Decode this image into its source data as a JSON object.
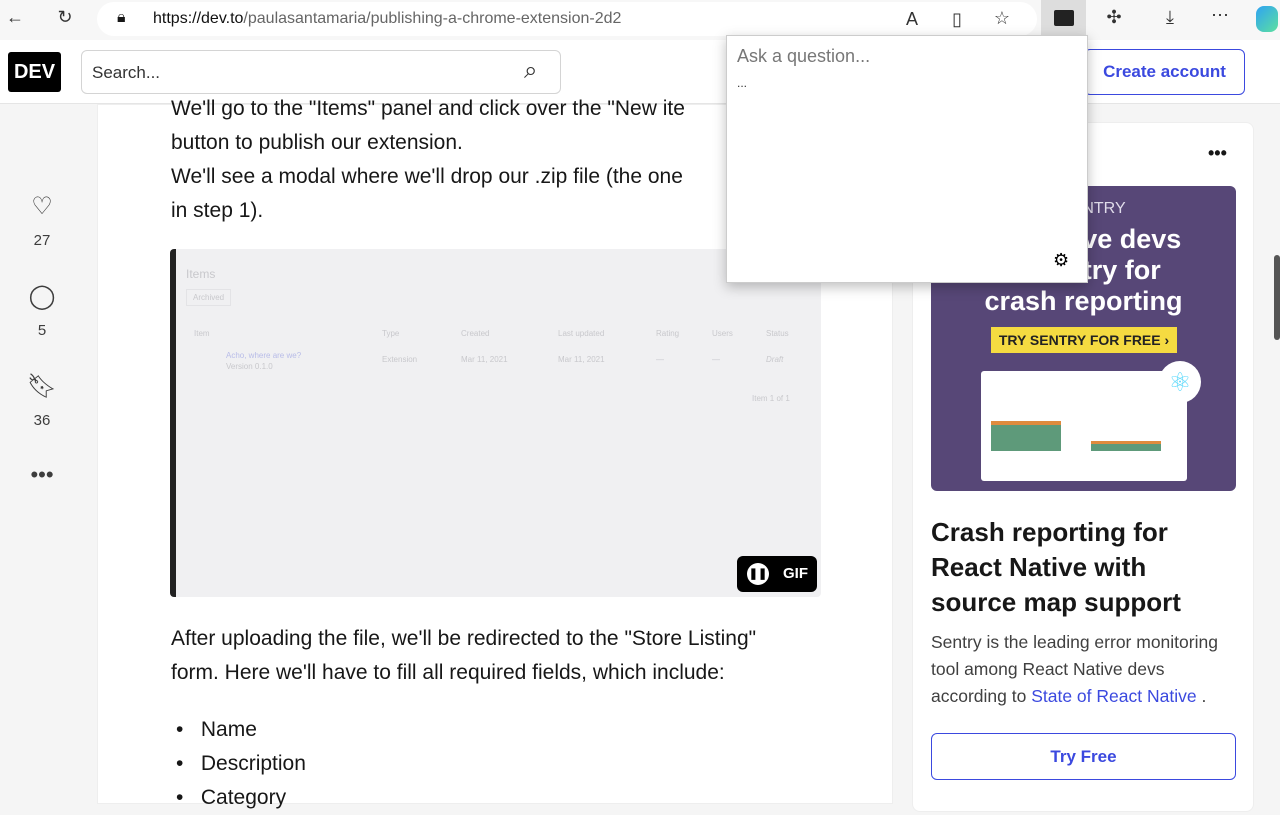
{
  "browser": {
    "url_host": "https://dev.to",
    "url_path": "/paulasantamaria/publishing-a-chrome-extension-2d2"
  },
  "header": {
    "logo": "DEV",
    "search_placeholder": "Search...",
    "create_account": "Create account"
  },
  "reactions": [
    {
      "icon": "heart-plus-icon",
      "count": "27"
    },
    {
      "icon": "comment-icon",
      "count": "5"
    },
    {
      "icon": "bookmark-icon",
      "count": "36"
    }
  ],
  "article": {
    "lines_top": [
      "We'll go to the \"Items\" panel and click over the \"New ite",
      "button to publish our extension.",
      "We'll see a modal where we'll drop our .zip file (the one",
      "in step 1)."
    ],
    "gif": {
      "title": "Items",
      "tab": "Archived",
      "columns": [
        "Item",
        "Type",
        "Created",
        "Last updated",
        "Rating",
        "Users",
        "Status"
      ],
      "row": {
        "name": "Acho, where are we?",
        "version": "Version 0.1.0",
        "type": "Extension",
        "created": "Mar 11, 2021",
        "updated": "Mar 11, 2021",
        "rating": "—",
        "users": "—",
        "status": "Draft"
      },
      "pager": "Item 1 of 1",
      "badge": "GIF"
    },
    "lines_bottom": [
      "After uploading the file, we'll be redirected to the \"Store Listing\"",
      "form. Here we'll have to fill all required fields, which include:"
    ],
    "list": [
      "Name",
      "Description",
      "Category"
    ]
  },
  "sidebar": {
    "ad": {
      "brand": "SENTRY",
      "headline": [
        "tive devs",
        "ntry for",
        "crash reporting"
      ],
      "cta": "TRY SENTRY FOR FREE ›"
    },
    "title": [
      "Crash reporting for",
      "React Native with",
      "source map support"
    ],
    "body_lines": [
      "Sentry is the leading error monitoring",
      "tool among React Native devs",
      "according to "
    ],
    "link": "State of React Native ",
    "body_end": ".",
    "button": "Try Free"
  },
  "popup": {
    "placeholder": "Ask a question...",
    "status": "..."
  }
}
